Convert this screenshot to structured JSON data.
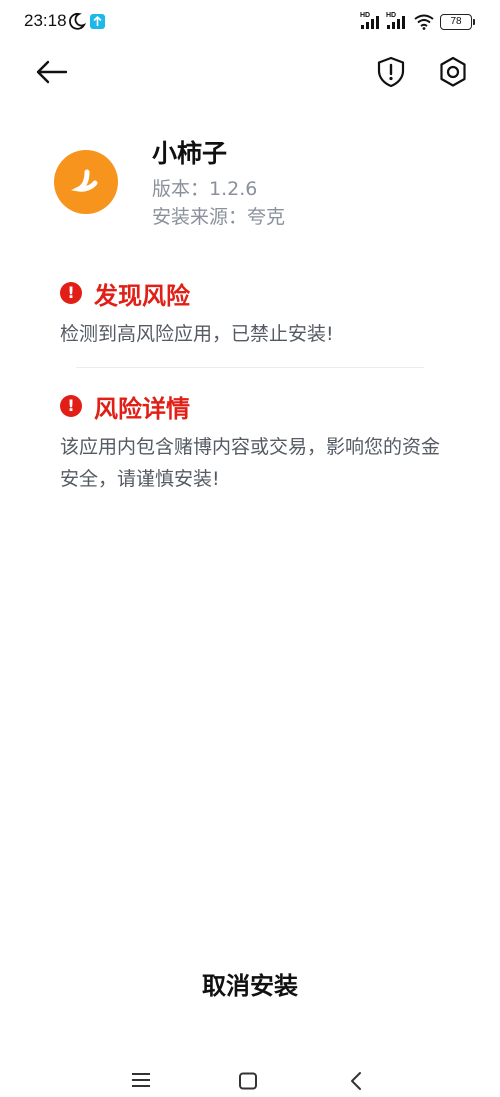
{
  "status_bar": {
    "time": "23:18",
    "signal1_label": "HD",
    "signal2_label": "HD",
    "battery": "78",
    "icons": [
      "moon-icon",
      "app-notification-icon",
      "signal-icon",
      "wifi-icon",
      "battery-icon"
    ]
  },
  "nav": {
    "icons": [
      "back-arrow-icon",
      "shield-alert-icon",
      "settings-gear-icon"
    ]
  },
  "app": {
    "name": "小柿子",
    "version": "版本：1.2.6",
    "source": "安装来源：夸克",
    "icon_color": "#f7941d"
  },
  "risk": {
    "title": "发现风险",
    "body": "检测到高风险应用，已禁止安装!",
    "alert_symbol": "!"
  },
  "details": {
    "title": "风险详情",
    "body": "该应用内包含赌博内容或交易，影响您的资金安全，请谨慎安装!",
    "alert_symbol": "!"
  },
  "actions": {
    "cancel_label": "取消安装"
  },
  "colors": {
    "alert_red": "#e11f16",
    "secondary_text": "#8a919c",
    "body_text": "#555b63"
  },
  "system_nav": {
    "icons": [
      "menu-icon",
      "home-icon",
      "back-icon"
    ]
  }
}
